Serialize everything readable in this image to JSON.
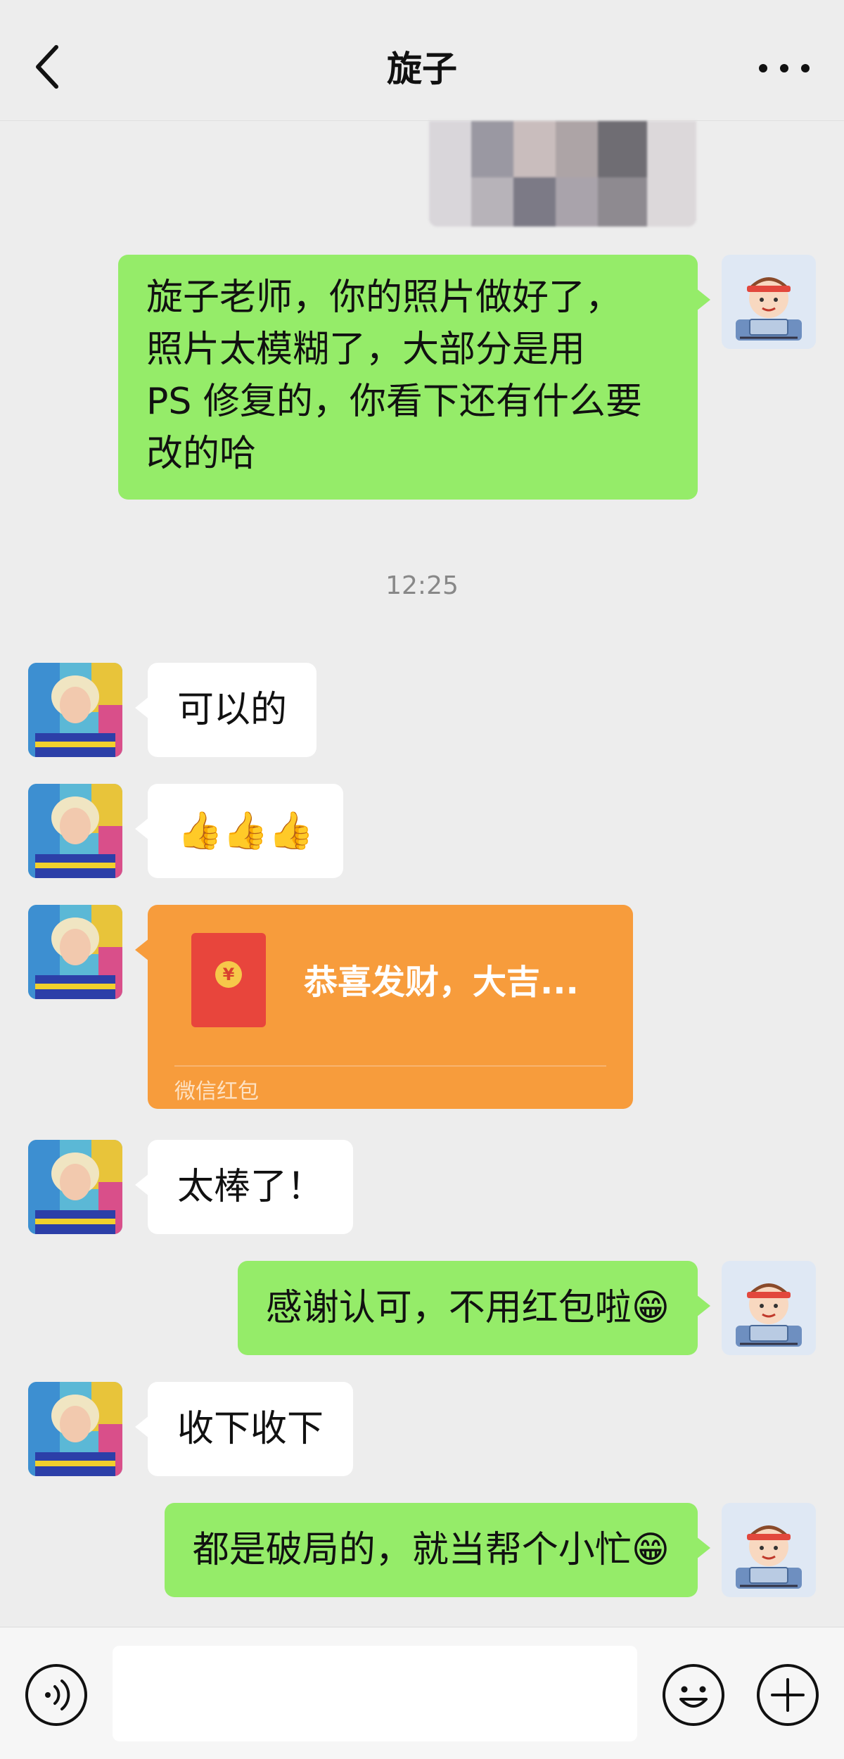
{
  "header": {
    "title": "旋子",
    "back_icon": "chevron-left-icon",
    "more_icon": "ellipsis-icon"
  },
  "messages": [
    {
      "from": "me",
      "lines": [
        "旋子老师，你的照片做好了，",
        "照片太模糊了，大部分是用",
        "PS 修复的，你看下还有什么要",
        "改的哈"
      ]
    },
    {
      "type": "time",
      "text": "12:25"
    },
    {
      "from": "her",
      "text": "可以的"
    },
    {
      "from": "her",
      "text": "👍👍👍"
    },
    {
      "from": "her",
      "type": "red_packet",
      "title": "恭喜发财，大吉...",
      "label": "微信红包"
    },
    {
      "from": "her",
      "text": "太棒了！"
    },
    {
      "from": "me",
      "text": "感谢认可，不用红包啦😁"
    },
    {
      "from": "her",
      "text": "收下收下"
    },
    {
      "from": "me",
      "text": "都是破局的，就当帮个小忙😁"
    }
  ],
  "input_bar": {
    "placeholder": "",
    "voice_icon": "voice-icon",
    "emoji_icon": "emoji-icon",
    "plus_icon": "plus-icon"
  },
  "colors": {
    "my_bubble": "#95ec69",
    "her_bubble": "#ffffff",
    "red_packet": "#f79c3c",
    "background": "#ededed"
  }
}
